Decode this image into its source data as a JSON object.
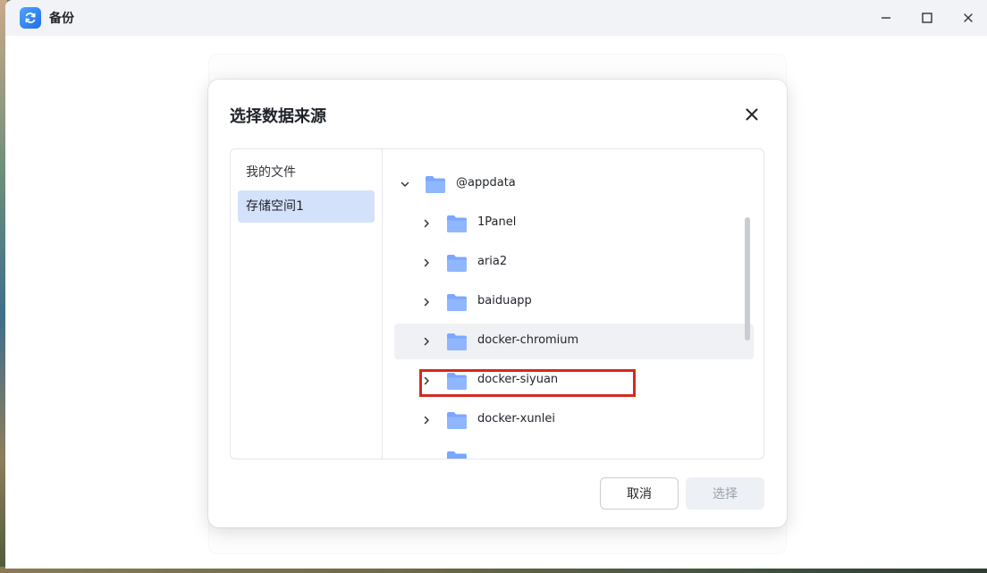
{
  "window": {
    "title": "备份",
    "icon": "backup-sync-icon",
    "controls": [
      "minimize-icon",
      "maximize-icon",
      "close-icon"
    ]
  },
  "dialog": {
    "title": "选择数据来源",
    "sidebar": {
      "items": [
        {
          "label": "我的文件",
          "active": false
        },
        {
          "label": "存储空间1",
          "active": true
        }
      ]
    },
    "tree": {
      "root": {
        "label": "@appdata",
        "expanded": true
      },
      "children": [
        {
          "label": "1Panel"
        },
        {
          "label": "aria2"
        },
        {
          "label": "baiduapp"
        },
        {
          "label": "docker-chromium",
          "hovered": true
        },
        {
          "label": "docker-siyuan",
          "highlighted": true
        },
        {
          "label": "docker-xunlei"
        }
      ]
    },
    "buttons": {
      "cancel": "取消",
      "select": "选择",
      "select_enabled": false
    }
  },
  "colors": {
    "accent": "#1f6fe8",
    "folder": "#7aa7ff",
    "active_item_bg": "#d3e1fa",
    "highlight_border": "#d42a1f"
  }
}
